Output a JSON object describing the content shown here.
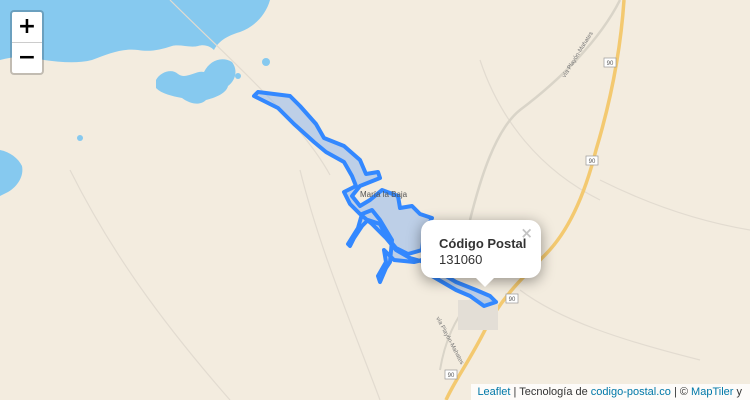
{
  "zoom": {
    "in_label": "+",
    "out_label": "−"
  },
  "popup": {
    "title": "Código Postal",
    "value": "131060",
    "close_label": "×"
  },
  "map_labels": {
    "town": "María la Baja",
    "road_upper": "vía Playón-Mahates",
    "road_lower": "vía Playón-Mahates",
    "route_shield": "90"
  },
  "attribution": {
    "leaflet": "Leaflet",
    "sep1": " | Tecnología de ",
    "codigo": "codigo-postal.co",
    "sep2": " | © ",
    "maptiler": "MapTiler",
    "tail": " y"
  },
  "colors": {
    "water": "#86c9ef",
    "land": "#f3ecdf",
    "polygon_stroke": "#3388ff",
    "polygon_fill": "#8fb8ec",
    "highway": "#f3c970"
  }
}
